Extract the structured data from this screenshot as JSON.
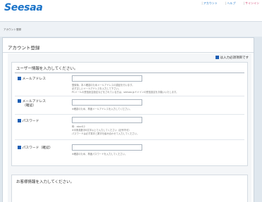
{
  "header": {
    "logo": "Seesaa",
    "nav": {
      "account": "アカウント",
      "help": "ヘルプ",
      "signin": "サインイン",
      "separator": "|"
    }
  },
  "breadcrumb": "アカウント登録",
  "card": {
    "title": "アカウント登録",
    "required_note": "は入力必須項目です"
  },
  "user_section": {
    "heading": "ユーザー情報を入力してください。",
    "fields": {
      "email": {
        "label": "メールアドレス",
        "help": [
          "登録後、本人確認のためメールアドレスの認証を行います。",
          "必ず正しいメールアドレスを入力して下さい。",
          "PCメールの受信拒否設定などをされている方は、seesaa.jpドメインの受信設定をお願いいたします。"
        ]
      },
      "email_confirm": {
        "label": "メールアドレス",
        "label_sub": "（確認）",
        "help": [
          "※確認のため、再度メールアドレスを入力してください。"
        ]
      },
      "password": {
        "label": "パスワード",
        "help": [
          "例：abcd12",
          "※半角英数字6文字以上で入力してください（記号不可）",
          "パスワードは必ず英字と数字を組み合わせて入力してください。"
        ]
      },
      "password_confirm": {
        "label": "パスワード（確認）",
        "help": [
          "※確認のため、再度パスワードを入力してください。"
        ]
      }
    }
  },
  "customer_section": {
    "heading": "お客様情報を入力してください。"
  },
  "colors": {
    "brand_blue": "#1a73c8",
    "signin_pink": "#d23a6a",
    "required_icon": "#1e5fb4",
    "page_bg": "#dfe7ee"
  }
}
